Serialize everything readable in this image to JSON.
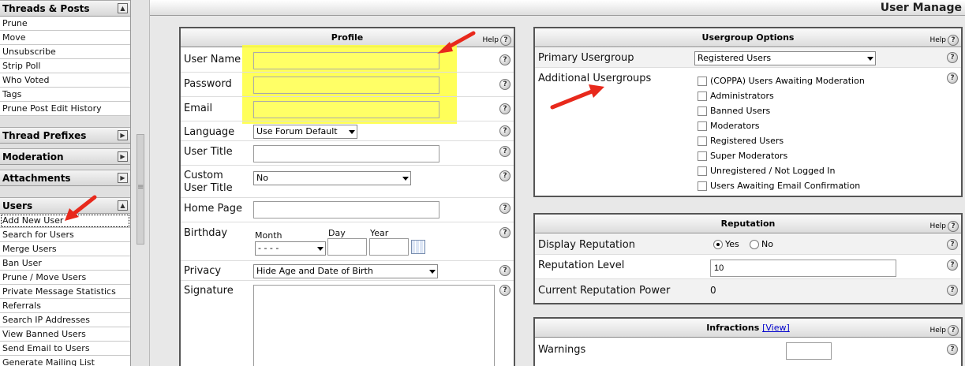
{
  "page_title": "User Manage",
  "sidebar": {
    "groups": [
      {
        "title": "Threads & Posts",
        "toggle": "▲",
        "items": [
          "Prune",
          "Move",
          "Unsubscribe",
          "Strip Poll",
          "Who Voted",
          "Tags",
          "Prune Post Edit History"
        ]
      },
      {
        "title": "Thread Prefixes",
        "toggle": "▶",
        "items": []
      },
      {
        "title": "Moderation",
        "toggle": "▶",
        "items": []
      },
      {
        "title": "Attachments",
        "toggle": "▶",
        "items": []
      },
      {
        "title": "Users",
        "toggle": "▲",
        "items": [
          "Add New User",
          "Search for Users",
          "Merge Users",
          "Ban User",
          "Prune / Move Users",
          "Private Message Statistics",
          "Referrals",
          "Search IP Addresses",
          "View Banned Users",
          "Send Email to Users",
          "Generate Mailing List"
        ]
      }
    ]
  },
  "help_label": "Help",
  "help_icon": "?",
  "profile": {
    "title": "Profile",
    "user_name": {
      "label": "User Name",
      "value": ""
    },
    "password": {
      "label": "Password",
      "value": ""
    },
    "email": {
      "label": "Email",
      "value": ""
    },
    "language": {
      "label": "Language",
      "selected": "Use Forum Default"
    },
    "user_title": {
      "label": "User Title",
      "value": ""
    },
    "custom_user_title": {
      "label_line1": "Custom",
      "label_line2": "User Title",
      "selected": "No"
    },
    "home_page": {
      "label": "Home Page",
      "value": ""
    },
    "birthday": {
      "label": "Birthday",
      "month_label": "Month",
      "day_label": "Day",
      "year_label": "Year",
      "month_selected": "- - - -"
    },
    "privacy": {
      "label": "Privacy",
      "selected": "Hide Age and Date of Birth"
    },
    "signature": {
      "label": "Signature"
    }
  },
  "usergroup": {
    "title": "Usergroup Options",
    "primary_label": "Primary Usergroup",
    "primary_selected": "Registered Users",
    "additional_label": "Additional Usergroups",
    "additional_options": [
      "(COPPA) Users Awaiting Moderation",
      "Administrators",
      "Banned Users",
      "Moderators",
      "Registered Users",
      "Super Moderators",
      "Unregistered / Not Logged In",
      "Users Awaiting Email Confirmation"
    ]
  },
  "reputation": {
    "title": "Reputation",
    "display_label": "Display Reputation",
    "yes_label": "Yes",
    "no_label": "No",
    "display_value": "Yes",
    "level_label": "Reputation Level",
    "level_value": "10",
    "power_label": "Current Reputation Power",
    "power_value": "0"
  },
  "infractions": {
    "title": "Infractions",
    "view_link": "[View]",
    "warnings_label": "Warnings",
    "warnings_value": ""
  },
  "colors": {
    "highlight": "#ffff44",
    "arrow": "#e8291c"
  }
}
